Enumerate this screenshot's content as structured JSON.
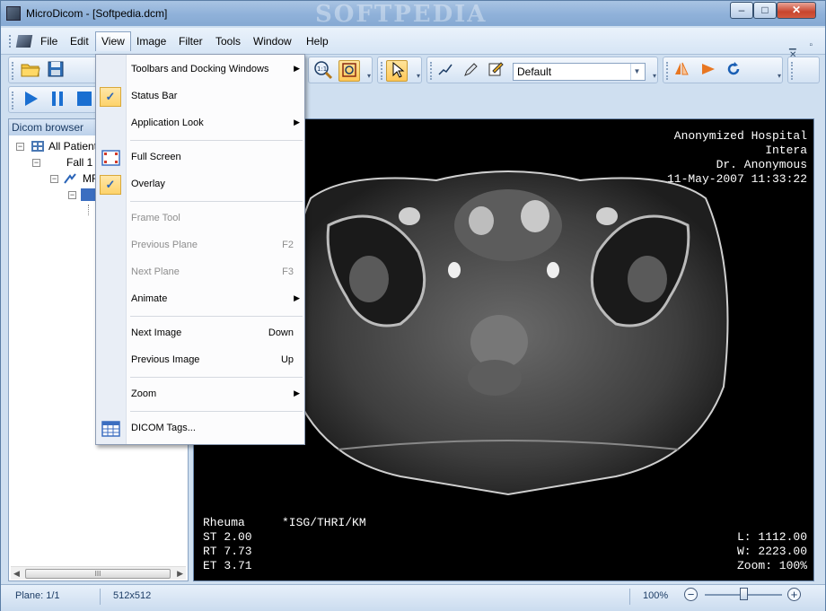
{
  "window": {
    "title": "MicroDicom - [Softpedia.dcm]",
    "watermark": "SOFTPEDIA",
    "controls": {
      "minimize": "–",
      "maximize": "□",
      "close": "✕"
    }
  },
  "menubar": {
    "items": [
      "File",
      "Edit",
      "View",
      "Image",
      "Filter",
      "Tools",
      "Window",
      "Help"
    ],
    "active": "View",
    "mdi_controls": "▁ ▫ ✕"
  },
  "toolbar": {
    "preset_value": "Default"
  },
  "browser": {
    "header": "Dicom browser",
    "tree": [
      {
        "label": "All Patient",
        "level": 0,
        "icon": "patients-icon",
        "expander": "−"
      },
      {
        "label": "Fall 1",
        "level": 1,
        "icon": "",
        "expander": "−"
      },
      {
        "label": "MF",
        "level": 2,
        "icon": "study-icon",
        "expander": "−"
      },
      {
        "label": "",
        "level": 3,
        "icon": "series-icon",
        "expander": "−"
      }
    ],
    "hscroll_grip": "III"
  },
  "viewer": {
    "overlay_top_right": [
      "Anonymized Hospital",
      "Intera",
      "Dr. Anonymous",
      "11-May-2007 11:33:22"
    ],
    "overlay_bottom_left_title": "Rheuma",
    "overlay_bottom_left_protocol": "*ISG/THRI/KM",
    "overlay_bottom_left": [
      "ST 2.00",
      "RT 7.73",
      "ET 3.71"
    ],
    "overlay_bottom_right": [
      "L: 1112.00",
      "W: 2223.00",
      "Zoom: 100%"
    ]
  },
  "view_menu": {
    "items": [
      {
        "label": "Toolbars and Docking Windows",
        "shortcut": "",
        "submenu": true,
        "checked": false,
        "disabled": false
      },
      {
        "label": "Status Bar",
        "shortcut": "",
        "submenu": false,
        "checked": true,
        "disabled": false
      },
      {
        "label": "Application Look",
        "shortcut": "",
        "submenu": true,
        "checked": false,
        "disabled": false
      },
      {
        "label": "Full Screen",
        "shortcut": "",
        "submenu": false,
        "checked": false,
        "disabled": false
      },
      {
        "label": "Overlay",
        "shortcut": "",
        "submenu": false,
        "checked": true,
        "disabled": false
      },
      {
        "label": "Frame Tool",
        "shortcut": "",
        "submenu": false,
        "checked": false,
        "disabled": true
      },
      {
        "label": "Previous Plane",
        "shortcut": "F2",
        "submenu": false,
        "checked": false,
        "disabled": true
      },
      {
        "label": "Next Plane",
        "shortcut": "F3",
        "submenu": false,
        "checked": false,
        "disabled": true
      },
      {
        "label": "Animate",
        "shortcut": "",
        "submenu": true,
        "checked": false,
        "disabled": false
      },
      {
        "label": "Next Image",
        "shortcut": "Down",
        "submenu": false,
        "checked": false,
        "disabled": false
      },
      {
        "label": "Previous Image",
        "shortcut": "Up",
        "submenu": false,
        "checked": false,
        "disabled": false
      },
      {
        "label": "Zoom",
        "shortcut": "",
        "submenu": true,
        "checked": false,
        "disabled": false
      },
      {
        "label": "DICOM Tags...",
        "shortcut": "",
        "submenu": false,
        "checked": false,
        "disabled": false
      }
    ],
    "check_glyph": "✓",
    "submenu_glyph": "▶"
  },
  "statusbar": {
    "plane": "Plane: 1/1",
    "dimensions": "512x512",
    "zoom": "100%",
    "zoom_minus": "−",
    "zoom_plus": "+",
    "zoom_level_fraction": 0.5
  }
}
